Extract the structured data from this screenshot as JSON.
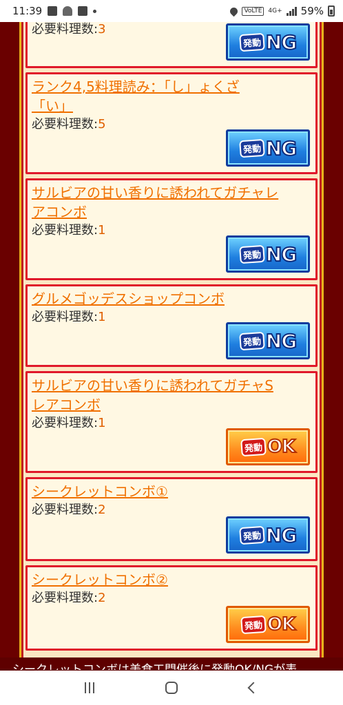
{
  "status_bar": {
    "time": "11:39",
    "battery": "59%",
    "network": "4G+",
    "volte": "VoLTE"
  },
  "cards": [
    {
      "title": "",
      "req_label": "必要料理数:",
      "req_value": "3",
      "status": "NG",
      "badge_left": "発動",
      "badge_right": "NG"
    },
    {
      "title": "ランク4,5料理読み：「し」ょくざ「い」",
      "title_line1": "ランク4,5料理読み：「し」ょくざ",
      "title_line2": "「い」",
      "req_label": "必要料理数:",
      "req_value": "5",
      "status": "NG",
      "badge_left": "発動",
      "badge_right": "NG"
    },
    {
      "title_line1": "サルビアの甘い香りに誘われてガチャレ",
      "title_line2": "アコンボ",
      "req_label": "必要料理数:",
      "req_value": "1",
      "status": "NG",
      "badge_left": "発動",
      "badge_right": "NG"
    },
    {
      "title_line1": "グルメゴッデスショップコンボ",
      "title_line2": "",
      "req_label": "必要料理数:",
      "req_value": "1",
      "status": "NG",
      "badge_left": "発動",
      "badge_right": "NG"
    },
    {
      "title_line1": "サルビアの甘い香りに誘われてガチャS",
      "title_line2": "レアコンボ",
      "req_label": "必要料理数:",
      "req_value": "1",
      "status": "OK",
      "badge_left": "発動",
      "badge_right": "OK"
    },
    {
      "title_line1": "シークレットコンボ①",
      "title_line2": "",
      "req_label": "必要料理数:",
      "req_value": "2",
      "status": "NG",
      "badge_left": "発動",
      "badge_right": "NG"
    },
    {
      "title_line1": "シークレットコンボ②",
      "title_line2": "",
      "req_label": "必要料理数:",
      "req_value": "2",
      "status": "OK",
      "badge_left": "発動",
      "badge_right": "OK"
    }
  ],
  "footer_text": "シークレットコンボは美食工門催後に発動OK/NGが表",
  "icons": {
    "status": [
      "image-icon",
      "photos-icon",
      "sim-icon",
      "dot-icon",
      "location-icon",
      "volte-icon",
      "signal-icon",
      "battery-icon"
    ],
    "nav": [
      "recents-icon",
      "home-icon",
      "back-icon"
    ]
  },
  "colors": {
    "title": "#f07000",
    "card_border": "#e0182a",
    "panel_border": "#e8b21a",
    "ng_badge": "#1f7fe0",
    "ok_badge": "#ff8d1f"
  }
}
